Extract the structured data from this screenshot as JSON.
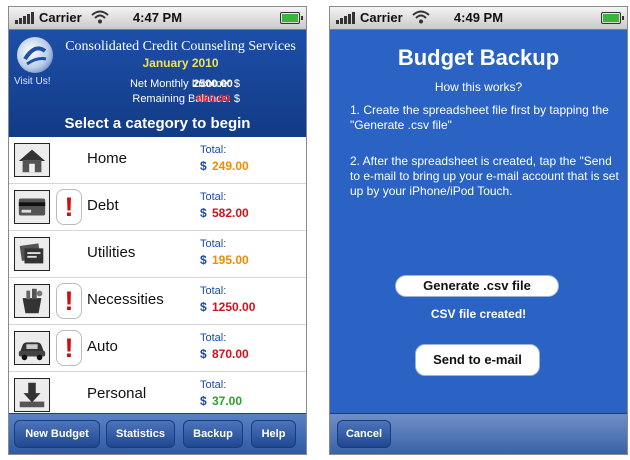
{
  "left_screen": {
    "status": {
      "carrier": "Carrier",
      "time": "4:47 PM"
    },
    "header": {
      "organization": "Consolidated Credit Counseling Services",
      "period": "January 2010",
      "visit_link": "Visit Us!",
      "net_income_label": "Net Monthly Income: $",
      "net_income_value": "2500.00",
      "remaining_label": "Remaining Balance: $",
      "remaining_value": "-883.00",
      "prompt": "Select a category to begin"
    },
    "categories": [
      {
        "name": "Home",
        "total_label": "Total:",
        "currency": "$",
        "amount": "249.00",
        "amount_color": "#f08c00",
        "warning": false,
        "icon": "house-icon"
      },
      {
        "name": "Debt",
        "total_label": "Total:",
        "currency": "$",
        "amount": "582.00",
        "amount_color": "#d0111a",
        "warning": true,
        "icon": "credit-card-icon"
      },
      {
        "name": "Utilities",
        "total_label": "Total:",
        "currency": "$",
        "amount": "195.00",
        "amount_color": "#f08c00",
        "warning": false,
        "icon": "bills-icon"
      },
      {
        "name": "Necessities",
        "total_label": "Total:",
        "currency": "$",
        "amount": "1250.00",
        "amount_color": "#d0111a",
        "warning": true,
        "icon": "groceries-icon"
      },
      {
        "name": "Auto",
        "total_label": "Total:",
        "currency": "$",
        "amount": "870.00",
        "amount_color": "#d0111a",
        "warning": true,
        "icon": "car-icon"
      },
      {
        "name": "Personal",
        "total_label": "Total:",
        "currency": "$",
        "amount": "37.00",
        "amount_color": "#2ca02c",
        "warning": false,
        "icon": "personal-download-icon"
      }
    ],
    "warning_glyph": "!",
    "toolbar": {
      "new_budget": "New Budget",
      "statistics": "Statistics",
      "backup": "Backup",
      "help": "Help"
    }
  },
  "right_screen": {
    "status": {
      "carrier": "Carrier",
      "time": "4:49 PM"
    },
    "title": "Budget Backup",
    "subtitle": "How this works?",
    "step1": "1. Create the spreadsheet file first by tapping the \"Generate .csv file\"",
    "step2": "2. After the spreadsheet is created, tap the \"Send to e-mail to bring up your e-mail account that is set up by your iPhone/iPod Touch.",
    "generate_button": "Generate .csv file",
    "status_message": "CSV file created!",
    "send_button": "Send to e-mail",
    "cancel_button": "Cancel"
  },
  "colors": {
    "header_blue": "#1d4fa8",
    "backup_blue": "#2a63c4",
    "accent_yellow": "#f2e24b",
    "negative_red": "#ff2020"
  }
}
